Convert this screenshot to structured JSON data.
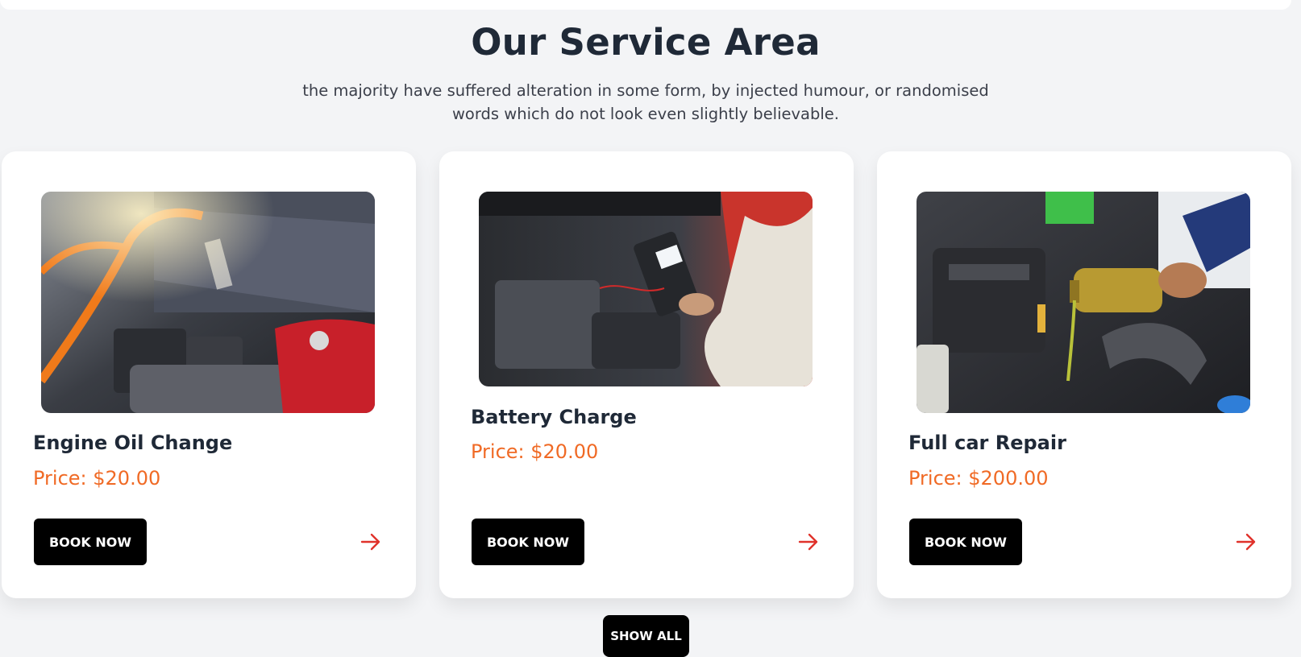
{
  "section": {
    "title": "Our Service Area",
    "description": "the majority have suffered alteration in some form, by injected humour, or randomised words which do not look even slightly believable."
  },
  "services": [
    {
      "title": "Engine Oil Change",
      "price": "Price: $20.00",
      "button": "BOOK NOW",
      "image": "engine-jumper-cables-image",
      "arrow": "arrow-right-icon"
    },
    {
      "title": "Battery Charge",
      "price": "Price: $20.00",
      "button": "BOOK NOW",
      "image": "battery-tester-image",
      "arrow": "arrow-right-icon"
    },
    {
      "title": "Full car Repair",
      "price": "Price: $200.00",
      "button": "BOOK NOW",
      "image": "oil-pouring-image",
      "arrow": "arrow-right-icon"
    }
  ],
  "show_all_label": "SHOW ALL",
  "colors": {
    "accent": "#f06a25",
    "arrow": "#e0322b",
    "button": "#000000",
    "background": "#f3f4f6"
  }
}
